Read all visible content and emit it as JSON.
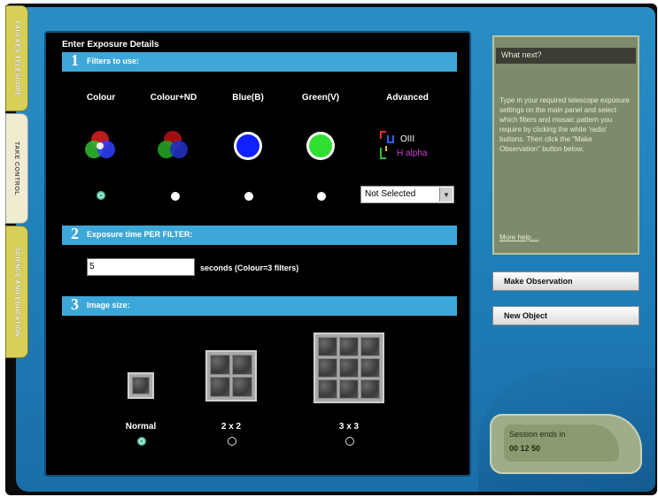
{
  "side_tabs": [
    {
      "label": "FAULKES TELESCOPE"
    },
    {
      "label": "TAKE CONTROL"
    },
    {
      "label": "SCIENCE AND EDUCATION"
    }
  ],
  "main": {
    "title": "Enter Exposure Details",
    "sections": [
      {
        "number": "1",
        "label": "Filters to use:"
      },
      {
        "number": "2",
        "label": "Exposure time PER FILTER:"
      },
      {
        "number": "3",
        "label": "Image size:"
      }
    ],
    "filters": [
      {
        "label": "Colour",
        "selected": true
      },
      {
        "label": "Colour+ND",
        "selected": false
      },
      {
        "label": "Blue(B)",
        "selected": false
      },
      {
        "label": "Green(V)",
        "selected": false
      },
      {
        "label": "Advanced"
      }
    ],
    "advanced": {
      "oiii": "OIII",
      "halpha": "H alpha",
      "select_value": "Not Selected"
    },
    "exposure": {
      "value": "5",
      "unit": "seconds (Colour=3 filters)"
    },
    "image_sizes": [
      {
        "label": "Normal",
        "selected": true
      },
      {
        "label": "2 x 2",
        "selected": false
      },
      {
        "label": "3 x 3",
        "selected": false
      }
    ]
  },
  "info": {
    "heading": "What next?",
    "body": "Type in your required telescope exposure settings on the main panel and select which filters and mosaic pattern you require by clicking the white 'radio' buttons. Then click the \"Make Observation\" button below.",
    "link": "More help...."
  },
  "buttons": {
    "make_observation": "Make Observation",
    "new_object": "New Object"
  },
  "session": {
    "label": "Session ends in",
    "time": "00 12 50"
  },
  "colors": {
    "section_bar": "#3ea7d9",
    "panel_bg": "#000000",
    "info_bg": "#7d8b6a",
    "tab_yellow": "#d8cf59"
  }
}
